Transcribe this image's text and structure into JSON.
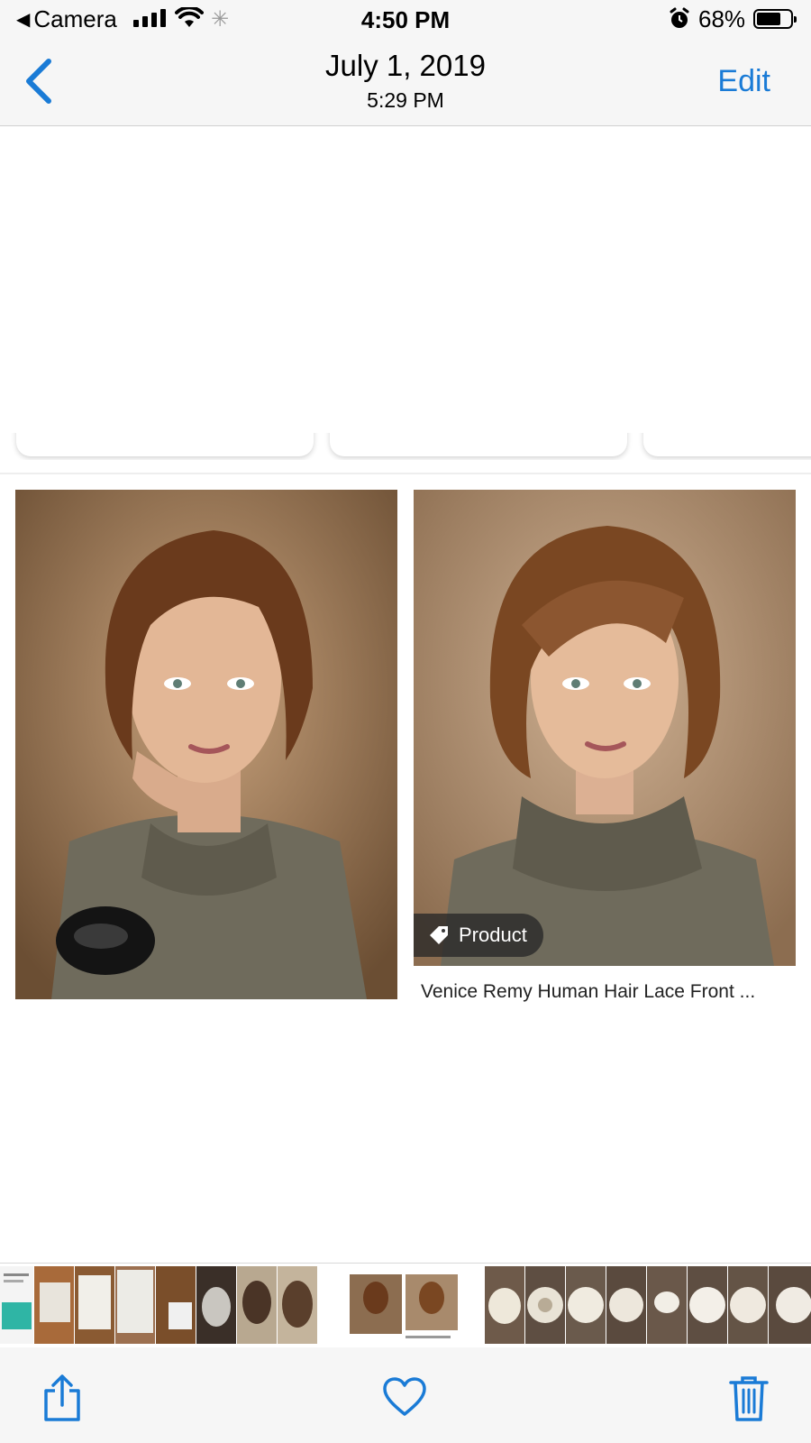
{
  "status_bar": {
    "back_app_label": "Camera",
    "time": "4:50 PM",
    "battery_percent": "68%",
    "signal_bars": 4,
    "battery_level": 0.68
  },
  "nav": {
    "back_icon": "chevron-left-icon",
    "title": "July 1, 2019",
    "subtitle": "5:29 PM",
    "edit_label": "Edit"
  },
  "results": [
    {
      "image": "woman-bob-hair-photo-1",
      "caption": ""
    },
    {
      "image": "woman-bob-hair-photo-2",
      "tag_label": "Product",
      "tag_icon": "tag-icon",
      "caption": "Venice Remy Human Hair Lace Front ..."
    }
  ],
  "toolbar": {
    "share_icon": "share-icon",
    "favorite_icon": "heart-icon",
    "delete_icon": "trash-icon"
  },
  "colors": {
    "accent": "#1a7bd6",
    "bar_background": "#f6f6f6"
  }
}
